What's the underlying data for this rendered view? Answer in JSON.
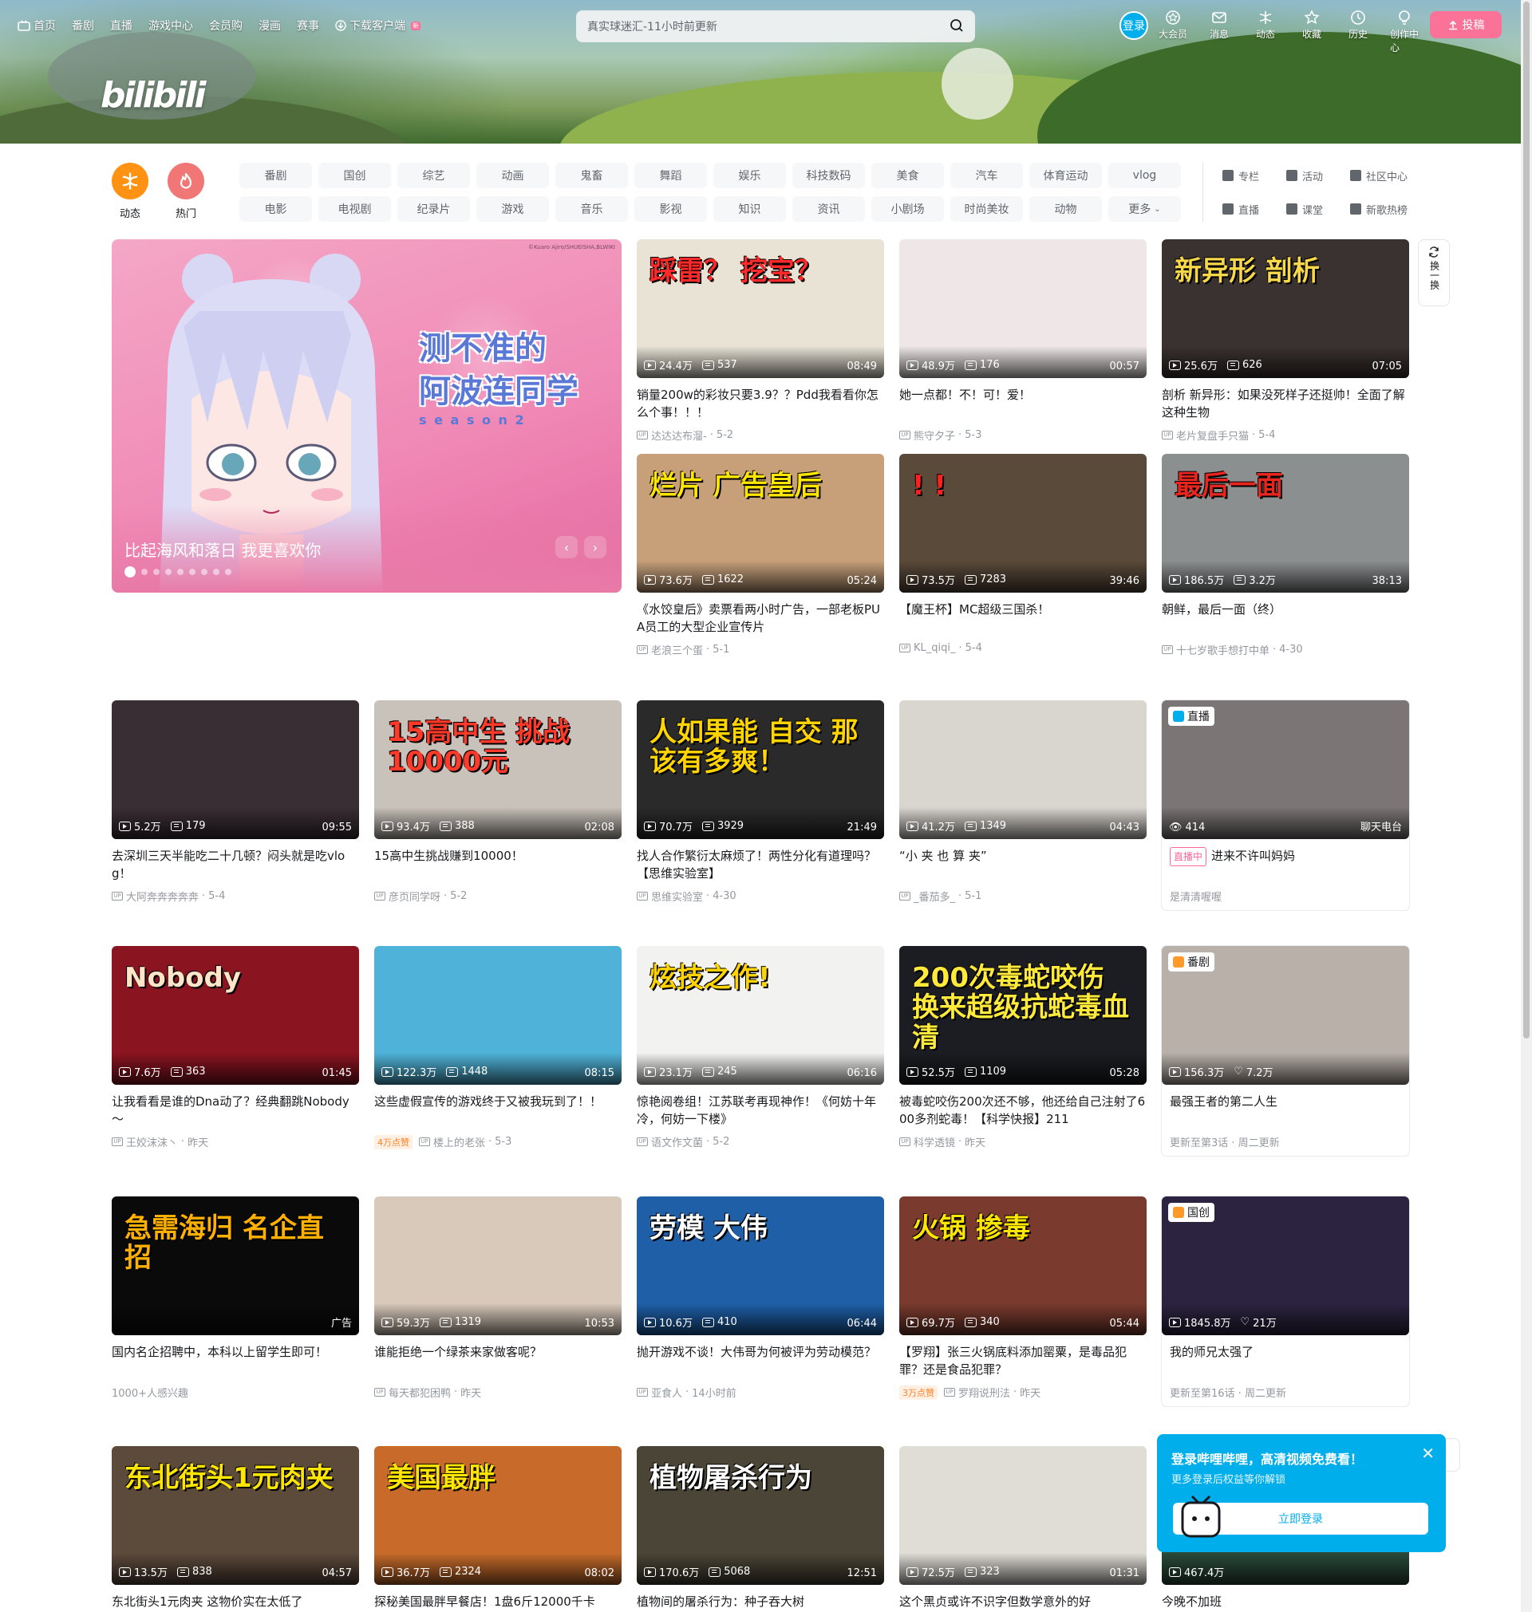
{
  "topnav": {
    "items": [
      {
        "icon": "tv-icon",
        "label": "首页"
      },
      {
        "label": "番剧"
      },
      {
        "label": "直播"
      },
      {
        "label": "游戏中心"
      },
      {
        "label": "会员购"
      },
      {
        "label": "漫画"
      },
      {
        "label": "赛事"
      },
      {
        "icon": "download-icon",
        "label": "下载客户端",
        "badge": "新"
      }
    ]
  },
  "search": {
    "placeholder": "真实球迷汇-11小时前更新"
  },
  "user": {
    "login_label": "登录",
    "icons": [
      {
        "name": "vip-icon",
        "label": "大会员"
      },
      {
        "name": "message-icon",
        "label": "消息"
      },
      {
        "name": "dynamic-icon",
        "label": "动态"
      },
      {
        "name": "favorite-icon",
        "label": "收藏"
      },
      {
        "name": "history-icon",
        "label": "历史"
      },
      {
        "name": "creator-icon",
        "label": "创作中心"
      }
    ],
    "upload_label": "投稿"
  },
  "logo": {
    "text": "bilibili"
  },
  "channels": {
    "round": [
      {
        "label": "动态",
        "color": "#ff9212"
      },
      {
        "label": "热门",
        "color": "#f07775"
      }
    ],
    "categories": [
      "番剧",
      "国创",
      "综艺",
      "动画",
      "鬼畜",
      "舞蹈",
      "娱乐",
      "科技数码",
      "美食",
      "汽车",
      "体育运动",
      "vlog",
      "电影",
      "电视剧",
      "纪录片",
      "游戏",
      "音乐",
      "影视",
      "知识",
      "资讯",
      "小剧场",
      "时尚美妆",
      "动物",
      "更多"
    ],
    "extra": [
      {
        "icon": "column-icon",
        "label": "专栏"
      },
      {
        "icon": "activity-icon",
        "label": "活动"
      },
      {
        "icon": "community-icon",
        "label": "社区中心"
      },
      {
        "icon": "live-icon",
        "label": "直播"
      },
      {
        "icon": "classroom-icon",
        "label": "课堂"
      },
      {
        "icon": "music-chart-icon",
        "label": "新歌热榜"
      }
    ]
  },
  "carousel": {
    "caption": "比起海风和落日 我更喜欢你",
    "art_title_line1": "测不准的",
    "art_title_line2": "阿波连同学",
    "art_season": "s e a s o n 2",
    "art_copyright": "©Kuaro Ajiro/SHUEISHA,BLWIKI",
    "prev": "‹",
    "next": "›",
    "slides": 9
  },
  "refresh": {
    "label": "换一换"
  },
  "videos": [
    {
      "views": "24.4万",
      "danmaku": "537",
      "duration": "08:49",
      "title": "销量200w的彩妆只要3.9？？Pdd我看看你怎么个事！！！",
      "author": "达达达布溜-",
      "date": "5-2",
      "art": "踩雷？ 挖宝？",
      "bg": "#e9e3d6",
      "artcolor": "#ff2a2a"
    },
    {
      "views": "48.9万",
      "danmaku": "176",
      "duration": "00:57",
      "title": "她一点都！不！可！爱！",
      "author": "熊守夕子",
      "date": "5-3",
      "art": "",
      "bg": "#efe7e7",
      "artcolor": "#333"
    },
    {
      "views": "25.6万",
      "danmaku": "626",
      "duration": "07:05",
      "title": "剖析 新异形：如果没死样子还挺帅！全面了解这种生物",
      "author": "老片复盘手只猫",
      "date": "5-4",
      "art": "新异形 剖析",
      "bg": "#3a3230",
      "artcolor": "#f7d84a"
    },
    {
      "views": "73.6万",
      "danmaku": "1622",
      "duration": "05:24",
      "title": "《水饺皇后》卖票看两小时广告，一部老板PUA员工的大型企业宣传片",
      "author": "老浪三个蛋",
      "date": "5-1",
      "art": "烂片 广告皇后",
      "bg": "#c7a07a",
      "artcolor": "#ffe600"
    },
    {
      "views": "73.5万",
      "danmaku": "7283",
      "duration": "39:46",
      "title": "【魔王杯】MC超级三国杀！",
      "author": "KL_qiqi_",
      "date": "5-4",
      "art": "! !",
      "bg": "#5a4a3a",
      "artcolor": "#ff2020"
    },
    {
      "views": "186.5万",
      "danmaku": "3.2万",
      "duration": "38:13",
      "title": "朝鲜，最后一面（终）",
      "author": "十七岁歌手想打中单",
      "date": "4-30",
      "art": "最后一面",
      "bg": "#8c8f90",
      "artcolor": "#e8251e"
    },
    {
      "views": "5.2万",
      "danmaku": "179",
      "duration": "09:55",
      "title": "去深圳三天半能吃二十几顿？闷头就是吃vlog！",
      "author": "大阿奔奔奔奔奔",
      "date": "5-4",
      "art": "",
      "bg": "#3a2e35",
      "artcolor": "#fff"
    },
    {
      "views": "93.4万",
      "danmaku": "388",
      "duration": "02:08",
      "title": "15高中生挑战赚到10000！",
      "author": "彦页同学呀",
      "date": "5-2",
      "art": "15高中生 挑战10000元",
      "bg": "#c9c2ba",
      "artcolor": "#ff3a2a"
    },
    {
      "views": "70.7万",
      "danmaku": "3929",
      "duration": "21:49",
      "title": "找人合作繁衍太麻烦了！两性分化有道理吗？【思维实验室】",
      "author": "思维实验室",
      "date": "4-30",
      "art": "人如果能 自交 那该有多爽！",
      "bg": "#2a2a2a",
      "artcolor": "#ffd400"
    },
    {
      "views": "41.2万",
      "danmaku": "1349",
      "duration": "04:43",
      "title": "“小 夹 也 算 夹”",
      "author": "_番茄多_",
      "date": "5-1",
      "art": "",
      "bg": "#d9d5cf",
      "artcolor": "#333"
    },
    {
      "live": true,
      "viewers": "414",
      "area": "聊天电台",
      "tag": "直播",
      "livebadge": "直播中",
      "title": "进来不许叫妈妈",
      "author": "是清清喔喔",
      "bg": "#7b7575"
    },
    {
      "views": "7.6万",
      "danmaku": "363",
      "duration": "01:45",
      "title": "让我看看是谁的Dna动了？经典翻跳Nobody～",
      "author": "王姣沫沫丶",
      "date": "昨天",
      "art": "Nobody",
      "bg": "#8a1420",
      "artcolor": "#ffe4c7"
    },
    {
      "views": "122.3万",
      "danmaku": "1448",
      "duration": "08:15",
      "title": "这些虚假宣传的游戏终于又被我玩到了！！",
      "author": "楼上的老张",
      "date": "5-3",
      "likes": "4万点赞",
      "art": "",
      "bg": "#4fb3d9",
      "artcolor": "#fff"
    },
    {
      "views": "23.1万",
      "danmaku": "245",
      "duration": "06:16",
      "title": "惊艳阅卷组！江苏联考再现神作！《何妨十年冷，何妨一下楼》",
      "author": "语文作文菌",
      "date": "5-2",
      "art": "炫技之作!",
      "bg": "#f2f2f0",
      "artcolor": "#ffd400"
    },
    {
      "views": "52.5万",
      "danmaku": "1109",
      "duration": "05:28",
      "title": "被毒蛇咬伤200次还不够，他还给自己注射了600多剂蛇毒！【科学快报】211",
      "author": "科学透镜",
      "date": "昨天",
      "art": "200次毒蛇咬伤 换来超级抗蛇毒血清",
      "bg": "#1c1d22",
      "artcolor": "#ffe93a"
    },
    {
      "bangumi": true,
      "tag": "番剧",
      "views": "156.3万",
      "follows": "7.2万",
      "title": "最强王者的第二人生",
      "meta": "更新至第3话 · 周二更新",
      "bg": "#b8b0a9"
    },
    {
      "ad": true,
      "title": "国内名企招聘中，本科以上留学生即可！",
      "meta": "1000+人感兴趣",
      "ad_label": "广告",
      "art": "急需海归 名企直招",
      "bg": "#0a0a0a",
      "artcolor": "#ffb000"
    },
    {
      "views": "59.3万",
      "danmaku": "1319",
      "duration": "10:53",
      "title": "谁能拒绝一个绿茶来家做客呢？",
      "author": "每天都犯困鸭",
      "date": "昨天",
      "art": "",
      "bg": "#d8c9bb",
      "artcolor": "#fff"
    },
    {
      "views": "10.6万",
      "danmaku": "410",
      "duration": "06:44",
      "title": "抛开游戏不谈！大伟哥为何被评为劳动模范？",
      "author": "亚食人",
      "date": "14小时前",
      "art": "劳模 大伟",
      "bg": "#1e5fa8",
      "artcolor": "#fff"
    },
    {
      "views": "69.7万",
      "danmaku": "340",
      "duration": "05:44",
      "title": "【罗翔】张三火锅底料添加罂粟，是毒品犯罪？还是食品犯罪？",
      "author": "罗翔说刑法",
      "date": "昨天",
      "likes": "3万点赞",
      "art": "火锅 掺毒",
      "bg": "#7a3b2e",
      "artcolor": "#ffe600"
    },
    {
      "bangumi": true,
      "tag": "国创",
      "views": "1845.8万",
      "follows": "21万",
      "title": "我的师兄太强了",
      "meta": "更新至第16话 · 周二更新",
      "bg": "#2c2340"
    },
    {
      "views": "13.5万",
      "danmaku": "838",
      "duration": "04:57",
      "title": "东北街头1元肉夹 这物价实在太低了",
      "author": "",
      "date": "",
      "art": "东北街头1元肉夹",
      "bg": "#5c4a3b",
      "artcolor": "#ffe600"
    },
    {
      "views": "36.7万",
      "danmaku": "2324",
      "duration": "08:02",
      "title": "探秘美国最胖早餐店！1盘6斤12000千卡",
      "author": "",
      "date": "",
      "art": "美国最胖",
      "bg": "#c76a2a",
      "artcolor": "#ffe600"
    },
    {
      "views": "170.6万",
      "danmaku": "5068",
      "duration": "12:51",
      "title": "植物间的屠杀行为：种子吞大树",
      "author": "",
      "date": "",
      "art": "植物屠杀行为",
      "bg": "#4a4536",
      "artcolor": "#fff"
    },
    {
      "views": "72.5万",
      "danmaku": "323",
      "duration": "01:31",
      "title": "这个黑贞或许不识字但数学意外的好",
      "author": "",
      "date": "",
      "art": "",
      "bg": "#e0ddd6",
      "artcolor": "#333"
    },
    {
      "views": "467.4万",
      "danmaku": "",
      "duration": "",
      "title": "今晚不加班",
      "author": "",
      "date": "",
      "art": "",
      "bg": "#2a4a3a",
      "artcolor": "#fff"
    }
  ],
  "login_popup": {
    "title": "登录哔哩哔哩，高清视频免费看！",
    "subtitle": "更多登录后权益等你解锁",
    "button": "立即登录",
    "close": "✕"
  }
}
